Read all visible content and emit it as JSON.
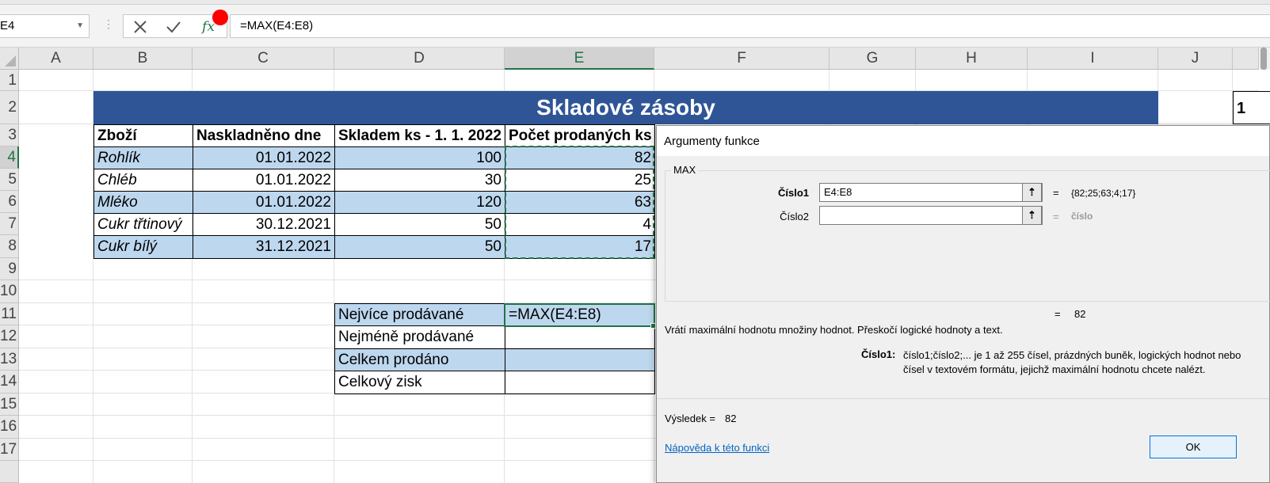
{
  "formula_bar": {
    "name_box": "E4",
    "fx_label": "fx",
    "formula": "=MAX(E4:E8)"
  },
  "columns": [
    "A",
    "B",
    "C",
    "D",
    "E",
    "F",
    "G",
    "H",
    "I",
    "J"
  ],
  "rows": [
    "1",
    "2",
    "3",
    "4",
    "5",
    "6",
    "7",
    "8",
    "9",
    "10",
    "11",
    "12",
    "13",
    "14",
    "15",
    "16",
    "17"
  ],
  "sheet": {
    "title": "Skladové zásoby",
    "j2_fragment": "1",
    "headers": [
      "Zboží",
      "Naskladněno dne",
      "Skladem ks - 1. 1. 2022",
      "Počet prodaných ks"
    ],
    "items": [
      {
        "name": "Rohlík",
        "date": "01.01.2022",
        "stock": "100",
        "sold": "82"
      },
      {
        "name": "Chléb",
        "date": "01.01.2022",
        "stock": "30",
        "sold": "25"
      },
      {
        "name": "Mléko",
        "date": "01.01.2022",
        "stock": "120",
        "sold": "63"
      },
      {
        "name": "Cukr třtinový",
        "date": "30.12.2021",
        "stock": "50",
        "sold": "4"
      },
      {
        "name": "Cukr bílý",
        "date": "31.12.2021",
        "stock": "50",
        "sold": "17"
      }
    ],
    "summary": [
      {
        "label": "Nejvíce prodávané",
        "value": "=MAX(E4:E8)"
      },
      {
        "label": "Nejméně prodávané",
        "value": ""
      },
      {
        "label": "Celkem prodáno",
        "value": ""
      },
      {
        "label": "Celkový zisk",
        "value": ""
      }
    ]
  },
  "dialog": {
    "title": "Argumenty funkce",
    "function_name": "MAX",
    "args": [
      {
        "label": "Číslo1",
        "value": "E4:E8",
        "eq": "=",
        "result": "{82;25;63;4;17}"
      },
      {
        "label": "Číslo2",
        "value": "",
        "eq": "=",
        "result": "číslo"
      }
    ],
    "formula_result_eq": "=",
    "formula_result_value": "82",
    "description": "Vrátí maximální hodnotu množiny hodnot. Přeskočí logické hodnoty a text.",
    "arg_desc_name": "Číslo1:",
    "arg_desc_text": "číslo1;číslo2;... je 1 až 255 čísel, prázdných buněk, logických hodnot nebo čísel v textovém formátu, jejichž maximální hodnotu chcete nalézt.",
    "result_label": "Výsledek =",
    "result_value": "82",
    "help_link": "Nápověda k této funkci",
    "ok_label": "OK"
  },
  "colors": {
    "excel_green": "#217346",
    "title_fill": "#2f5597",
    "row_fill": "#bdd7ee",
    "record_dot": "#ff0000"
  }
}
